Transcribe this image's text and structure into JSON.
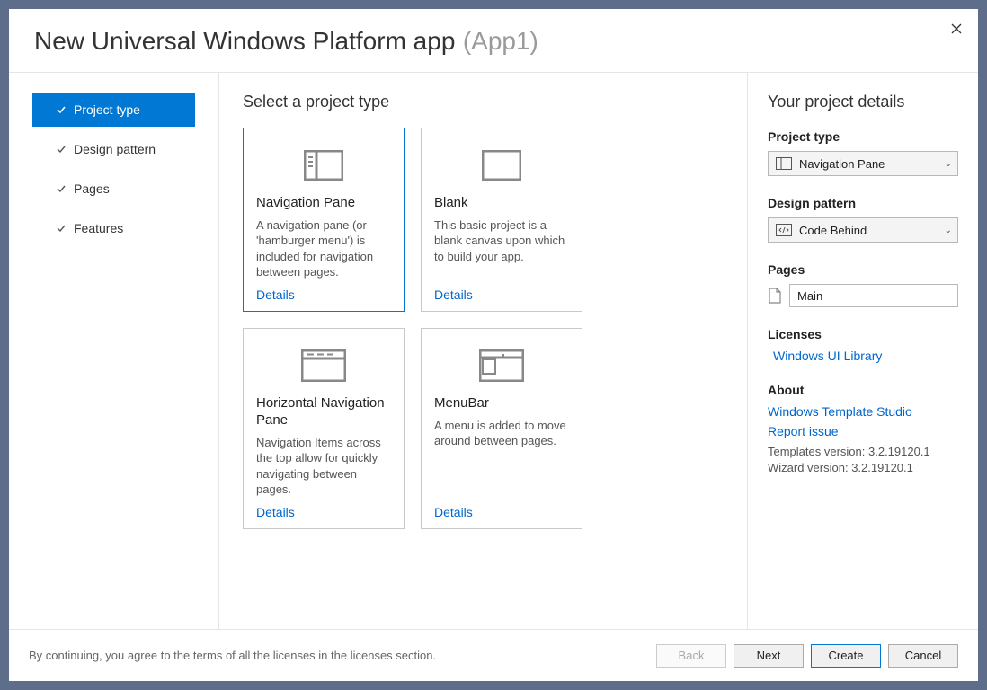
{
  "window": {
    "title": "New Universal Windows Platform app",
    "subtitle": "(App1)"
  },
  "sidebar": {
    "items": [
      {
        "label": "Project type"
      },
      {
        "label": "Design pattern"
      },
      {
        "label": "Pages"
      },
      {
        "label": "Features"
      }
    ]
  },
  "main": {
    "heading": "Select a project type",
    "cards": [
      {
        "title": "Navigation Pane",
        "desc": "A navigation pane (or 'hamburger menu') is included for navigation between pages.",
        "link": "Details"
      },
      {
        "title": "Blank",
        "desc": "This basic project is a blank canvas upon which to build your app.",
        "link": "Details"
      },
      {
        "title": "Horizontal Navigation Pane",
        "desc": "Navigation Items across the top allow for quickly navigating between pages.",
        "link": "Details"
      },
      {
        "title": "MenuBar",
        "desc": "A menu is added to move around between pages.",
        "link": "Details"
      }
    ]
  },
  "details": {
    "heading": "Your project details",
    "project_type_label": "Project type",
    "project_type_value": "Navigation Pane",
    "design_pattern_label": "Design pattern",
    "design_pattern_value": "Code Behind",
    "pages_label": "Pages",
    "page_name": "Main",
    "licenses_label": "Licenses",
    "license_link": "Windows UI Library",
    "about_label": "About",
    "about_link1": "Windows Template Studio",
    "about_link2": "Report issue",
    "templates_version": "Templates version: 3.2.19120.1",
    "wizard_version": "Wizard version: 3.2.19120.1"
  },
  "footer": {
    "disclaimer": "By continuing, you agree to the terms of all the licenses in the licenses section.",
    "back": "Back",
    "next": "Next",
    "create": "Create",
    "cancel": "Cancel"
  }
}
